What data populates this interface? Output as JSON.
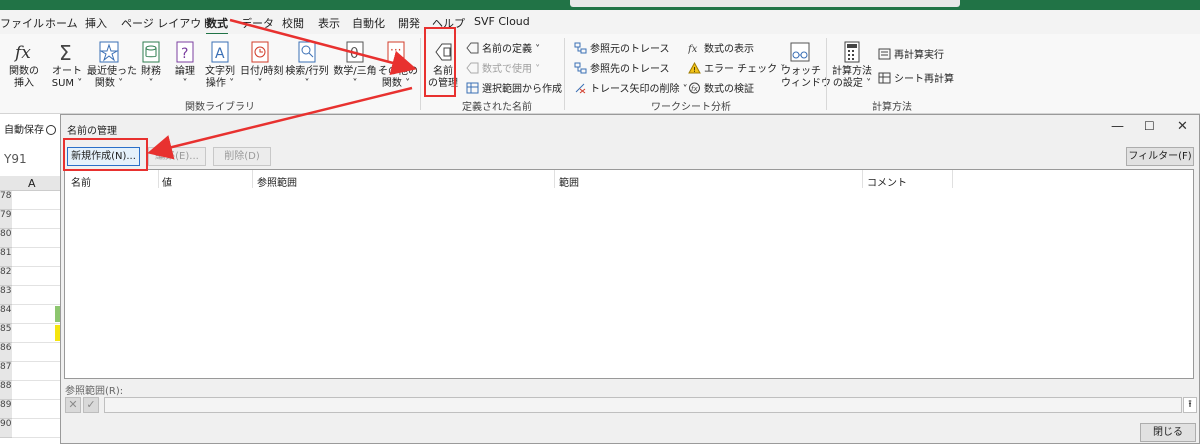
{
  "ribbon_tabs": [
    "ファイル",
    "ホーム",
    "挿入",
    "ページ レイアウト",
    "数式",
    "データ",
    "校閲",
    "表示",
    "自動化",
    "開発",
    "ヘルプ",
    "SVF Cloud"
  ],
  "active_tab": "数式",
  "function_library": {
    "insert_function": "関数の\n挿入",
    "autosum": "オート\nSUM ˅",
    "recently_used": "最近使った\n関数 ˅",
    "financial": "財務\n˅",
    "logical": "論理\n˅",
    "text": "文字列\n操作 ˅",
    "datetime": "日付/時刻\n˅",
    "lookup": "検索/行列\n˅",
    "math": "数学/三角\n˅",
    "more": "その他の\n関数 ˅",
    "group_label": "関数ライブラリ"
  },
  "defined_names": {
    "name_manager": "名前\nの管理",
    "define_name": "名前の定義 ˅",
    "use_in_formula": "数式で使用 ˅",
    "create_from_selection": "選択範囲から作成",
    "group_label": "定義された名前"
  },
  "formula_auditing": {
    "trace_precedents": "参照元のトレース",
    "trace_dependents": "参照先のトレース",
    "remove_arrows": "トレース矢印の削除 ˅",
    "show_formulas": "数式の表示",
    "error_checking": "エラー チェック ˅",
    "evaluate_formula": "数式の検証",
    "watch_window": "ウォッチ\nウィンドウ",
    "group_label": "ワークシート分析"
  },
  "calculation": {
    "calc_options": "計算方法\nの設定 ˅",
    "calc_now": "再計算実行",
    "calc_sheet": "シート再計算",
    "group_label": "計算方法"
  },
  "sheet": {
    "autosave": "自動保存",
    "name_box": "Y91",
    "column": "A",
    "rows": [
      "78",
      "79",
      "80",
      "81",
      "82",
      "83",
      "84",
      "85",
      "86",
      "87",
      "88",
      "89",
      "90"
    ]
  },
  "dialog": {
    "title": "名前の管理",
    "new_button": "新規作成(N)...",
    "edit_button": "編集(E)...",
    "delete_button": "削除(D)",
    "filter_button": "フィルター(F) ▾",
    "columns": [
      "名前",
      "値",
      "参照範囲",
      "範囲",
      "コメント"
    ],
    "refers_to_label": "参照範囲(R):",
    "close_button": "閉じる",
    "cancel_glyph": "✕",
    "confirm_glyph": "✓",
    "collapse_glyph": "⭱"
  },
  "colors": {
    "excel_green": "#217346",
    "annotation_red": "#e8312f"
  }
}
